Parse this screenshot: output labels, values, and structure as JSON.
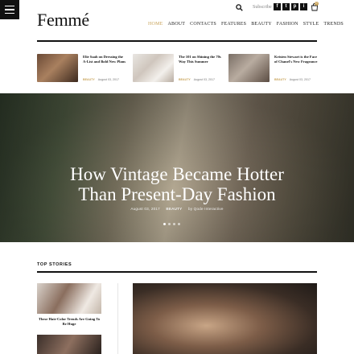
{
  "header": {
    "logo": "Femmé",
    "subscribe_label": "Subscribe",
    "social": [
      {
        "icon": "facebook-icon",
        "glyph": "f"
      },
      {
        "icon": "twitter-icon",
        "glyph": "t"
      },
      {
        "icon": "pinterest-icon",
        "glyph": "p"
      },
      {
        "icon": "instagram-icon",
        "glyph": "i"
      }
    ],
    "cart_count": "0",
    "nav": [
      {
        "label": "HOME",
        "active": true
      },
      {
        "label": "ABOUT"
      },
      {
        "label": "CONTACTS"
      },
      {
        "label": "FEATURES"
      },
      {
        "label": "BEAUTY"
      },
      {
        "label": "FASHION"
      },
      {
        "label": "STYLE"
      },
      {
        "label": "TRENDS"
      }
    ]
  },
  "trending": [
    {
      "title": "Elie Saab on Dressing the A-List and Bold New Plans",
      "category": "BEAUTY",
      "date": "August 03, 2017"
    },
    {
      "title": "The 101 on Shining the 70s Way This Summer",
      "category": "BEAUTY",
      "date": "August 03, 2017"
    },
    {
      "title": "Kristen Stewart is the Face of Chanel's New Fragrance",
      "category": "BEAUTY",
      "date": "August 03, 2017"
    }
  ],
  "hero": {
    "title_line1": "How Vintage Became Hotter",
    "title_line2": "Than Present-Day Fashion",
    "date": "August 03, 2017",
    "category": "BEAUTY",
    "author": "by Qode Interactive"
  },
  "top_stories": {
    "label": "TOP STORIES",
    "first_title": "These Hair-Color Trends Are Going To Be Huge"
  },
  "colors": {
    "accent": "#c9a45b",
    "text": "#111111",
    "background": "#ffffff"
  }
}
